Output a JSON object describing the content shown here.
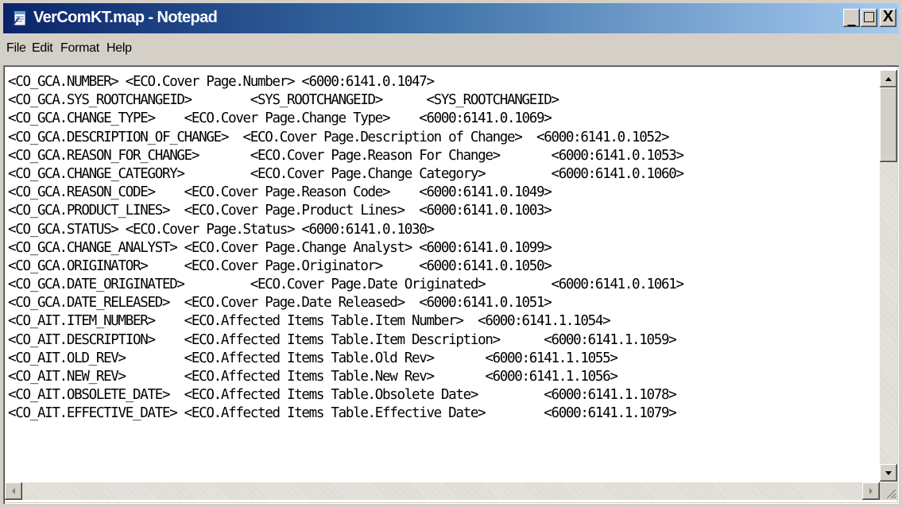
{
  "window": {
    "title": "VerComKT.map - Notepad",
    "minimize_symbol": "_",
    "maximize_symbol": "□",
    "close_symbol": "X"
  },
  "menu": {
    "items": [
      "File",
      "Edit",
      "Format",
      "Help"
    ]
  },
  "editor": {
    "lines": [
      "<CO_GCA.NUMBER> <ECO.Cover Page.Number> <6000:6141.0.1047>",
      "<CO_GCA.SYS_ROOTCHANGEID>        <SYS_ROOTCHANGEID>      <SYS_ROOTCHANGEID>",
      "<CO_GCA.CHANGE_TYPE>    <ECO.Cover Page.Change Type>    <6000:6141.0.1069>",
      "<CO_GCA.DESCRIPTION_OF_CHANGE>  <ECO.Cover Page.Description of Change>  <6000:6141.0.1052>",
      "<CO_GCA.REASON_FOR_CHANGE>       <ECO.Cover Page.Reason For Change>       <6000:6141.0.1053>",
      "<CO_GCA.CHANGE_CATEGORY>         <ECO.Cover Page.Change Category>         <6000:6141.0.1060>",
      "<CO_GCA.REASON_CODE>    <ECO.Cover Page.Reason Code>    <6000:6141.0.1049>",
      "<CO_GCA.PRODUCT_LINES>  <ECO.Cover Page.Product Lines>  <6000:6141.0.1003>",
      "<CO_GCA.STATUS> <ECO.Cover Page.Status> <6000:6141.0.1030>",
      "<CO_GCA.CHANGE_ANALYST> <ECO.Cover Page.Change Analyst> <6000:6141.0.1099>",
      "<CO_GCA.ORIGINATOR>     <ECO.Cover Page.Originator>     <6000:6141.0.1050>",
      "<CO_GCA.DATE_ORIGINATED>         <ECO.Cover Page.Date Originated>         <6000:6141.0.1061>",
      "<CO_GCA.DATE_RELEASED>  <ECO.Cover Page.Date Released>  <6000:6141.0.1051>",
      "<CO_AIT.ITEM_NUMBER>    <ECO.Affected Items Table.Item Number>  <6000:6141.1.1054>",
      "<CO_AIT.DESCRIPTION>    <ECO.Affected Items Table.Item Description>      <6000:6141.1.1059>",
      "<CO_AIT.OLD_REV>        <ECO.Affected Items Table.Old Rev>       <6000:6141.1.1055>",
      "<CO_AIT.NEW_REV>        <ECO.Affected Items Table.New Rev>       <6000:6141.1.1056>",
      "<CO_AIT.OBSOLETE_DATE>  <ECO.Affected Items Table.Obsolete Date>         <6000:6141.1.1078>",
      "<CO_AIT.EFFECTIVE_DATE> <ECO.Affected Items Table.Effective Date>        <6000:6141.1.1079>"
    ]
  },
  "icons": {
    "app": "notepad-icon",
    "scroll_up": "arrow-up-icon",
    "scroll_down": "arrow-down-icon",
    "scroll_left": "arrow-left-icon",
    "scroll_right": "arrow-right-icon"
  },
  "colors": {
    "titlebar_start": "#0a246a",
    "titlebar_end": "#a6caf0",
    "chrome": "#d4d0c8"
  }
}
